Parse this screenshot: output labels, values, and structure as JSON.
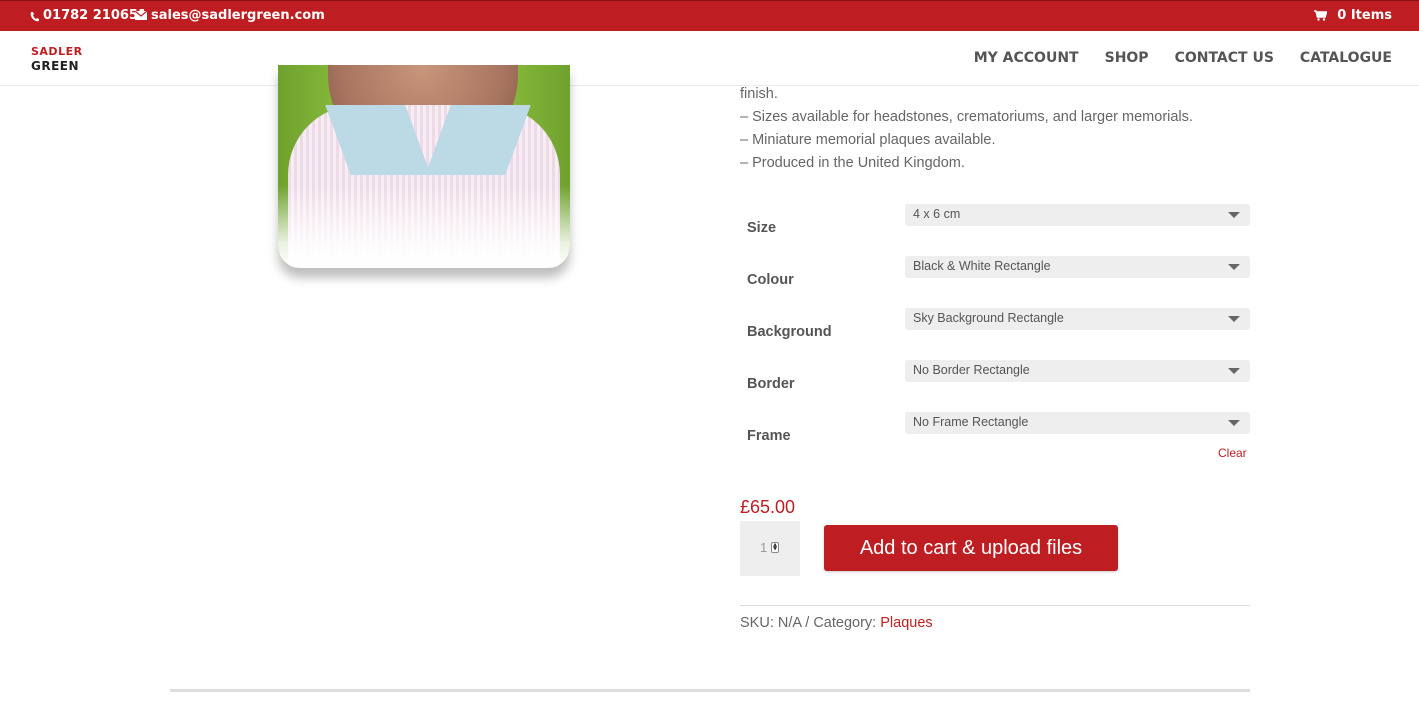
{
  "topbar": {
    "phone": "01782 210651",
    "email": "sales@sadlergreen.com",
    "cart": "0 Items",
    "background_color": "#be1e22"
  },
  "header": {
    "logo_top": "sadler",
    "logo_bottom": "green",
    "nav": [
      {
        "label": "MY ACCOUNT"
      },
      {
        "label": "SHOP"
      },
      {
        "label": "CONTACT US"
      },
      {
        "label": "CATALOGUE"
      }
    ]
  },
  "product": {
    "description": [
      "finish.",
      "– Sizes available for headstones, crematoriums, and larger memorials.",
      "– Miniature memorial plaques available.",
      "– Produced in the United Kingdom."
    ],
    "variations": [
      {
        "label": "Size",
        "value": "4 x 6 cm"
      },
      {
        "label": "Colour",
        "value": "Black & White Rectangle"
      },
      {
        "label": "Background",
        "value": "Sky Background Rectangle"
      },
      {
        "label": "Border",
        "value": "No Border Rectangle"
      },
      {
        "label": "Frame",
        "value": "No Frame Rectangle"
      }
    ],
    "clear_label": "Clear",
    "price": "£65.00",
    "quantity": "1",
    "add_to_cart_label": "Add to cart & upload files",
    "meta_prefix": "SKU: N/A / Category:",
    "category": "Plaques",
    "accent_color": "#be1e22"
  }
}
